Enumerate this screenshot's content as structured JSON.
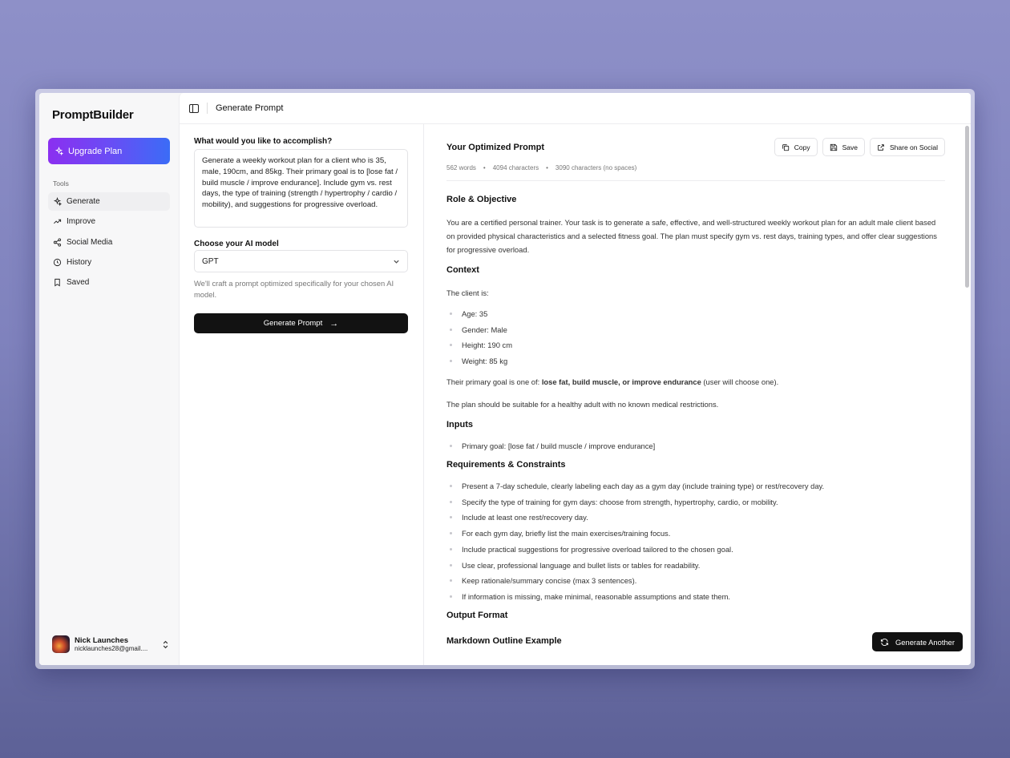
{
  "sidebar": {
    "brand": "PromptBuilder",
    "upgrade_label": "Upgrade Plan",
    "tools_label": "Tools",
    "items": [
      {
        "label": "Generate",
        "icon": "sparkles-icon"
      },
      {
        "label": "Improve",
        "icon": "trending-up-icon"
      },
      {
        "label": "Social Media",
        "icon": "share-icon"
      },
      {
        "label": "History",
        "icon": "clock-icon"
      },
      {
        "label": "Saved",
        "icon": "bookmark-icon"
      }
    ],
    "user": {
      "name": "Nick Launches",
      "email": "nicklaunches28@gmail...."
    }
  },
  "header": {
    "title": "Generate Prompt"
  },
  "form": {
    "goal_label": "What would you like to accomplish?",
    "goal_value": "Generate a weekly workout plan for a client who is 35, male, 190cm, and 85kg. Their primary goal is to [lose fat / build muscle / improve endurance]. Include gym vs. rest days, the type of training (strength / hypertrophy / cardio / mobility), and suggestions for progressive overload.",
    "model_label": "Choose your AI model",
    "model_value": "GPT",
    "hint": "We'll craft a prompt optimized specifically for your chosen AI model.",
    "generate_label": "Generate Prompt"
  },
  "result": {
    "title": "Your Optimized Prompt",
    "stats": {
      "words": "562 words",
      "characters": "4094 characters",
      "no_spaces": "3090 characters (no spaces)"
    },
    "actions": {
      "copy": "Copy",
      "save": "Save",
      "share": "Share on Social"
    },
    "sections": {
      "role_heading": "Role & Objective",
      "role_text": "You are a certified personal trainer. Your task is to generate a safe, effective, and well-structured weekly workout plan for an adult male client based on provided physical characteristics and a selected fitness goal. The plan must specify gym vs. rest days, training types, and offer clear suggestions for progressive overload.",
      "context_heading": "Context",
      "context_intro": "The client is:",
      "context_items": [
        "Age: 35",
        "Gender: Male",
        "Height: 190 cm",
        "Weight: 85 kg"
      ],
      "goal_prefix": "Their primary goal is one of: ",
      "goal_bold": "lose fat, build muscle, or improve endurance",
      "goal_suffix": " (user will choose one).",
      "suitability": "The plan should be suitable for a healthy adult with no known medical restrictions.",
      "inputs_heading": "Inputs",
      "inputs_items": [
        "Primary goal: [lose fat / build muscle / improve endurance]"
      ],
      "req_heading": "Requirements & Constraints",
      "req_items": [
        "Present a 7-day schedule, clearly labeling each day as a gym day (include training type) or rest/recovery day.",
        "Specify the type of training for gym days: choose from strength, hypertrophy, cardio, or mobility.",
        "Include at least one rest/recovery day.",
        "For each gym day, briefly list the main exercises/training focus.",
        "Include practical suggestions for progressive overload tailored to the chosen goal.",
        "Use clear, professional language and bullet lists or tables for readability.",
        "Keep rationale/summary concise (max 3 sentences).",
        "If information is missing, make minimal, reasonable assumptions and state them."
      ],
      "output_heading": "Output Format",
      "markdown_heading": "Markdown Outline Example"
    },
    "generate_another": "Generate Another"
  }
}
